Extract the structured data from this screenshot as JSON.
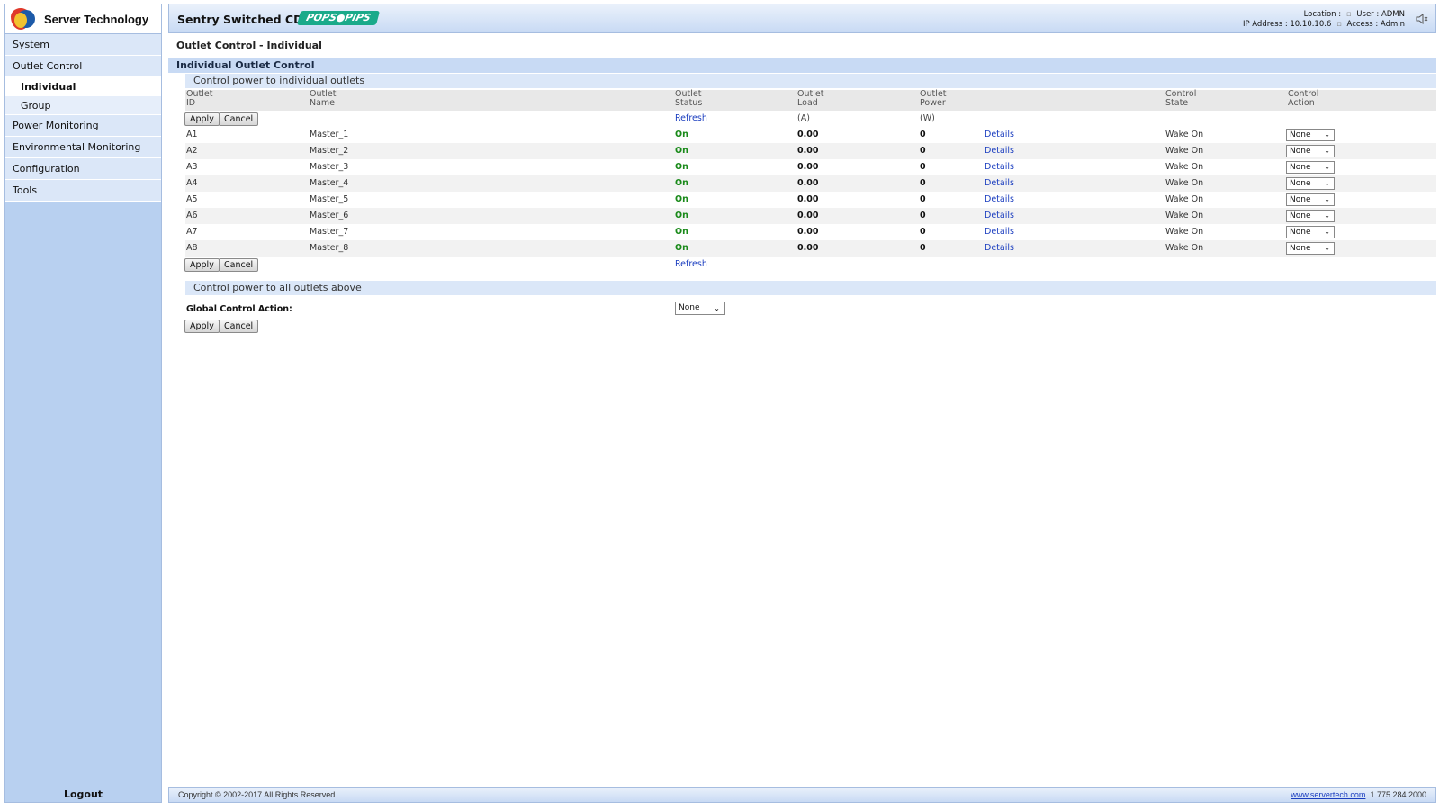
{
  "brand": {
    "company": "Server Technology",
    "product": "Sentry Switched CDU",
    "badge": "POPS●PIPS",
    "accent": "#1aaa8a"
  },
  "header": {
    "location_label": "Location :",
    "location_value": "",
    "user_label": "User : ADMN",
    "ip_label": "IP Address : 10.10.10.6",
    "access_label": "Access : Admin",
    "speaker_icon": "speaker-mute-icon"
  },
  "sidebar": {
    "items": [
      {
        "label": "System"
      },
      {
        "label": "Outlet Control"
      },
      {
        "label": "Individual",
        "active": true
      },
      {
        "label": "Group"
      },
      {
        "label": "Power Monitoring"
      },
      {
        "label": "Environmental Monitoring"
      },
      {
        "label": "Configuration"
      },
      {
        "label": "Tools"
      }
    ],
    "logout": "Logout"
  },
  "page": {
    "title": "Outlet Control - Individual",
    "section": "Individual Outlet Control",
    "subhead_individual": "Control power to individual outlets",
    "subhead_all": "Control power to all outlets above",
    "global_label": "Global Control Action:",
    "global_value": "None"
  },
  "table": {
    "headers": {
      "id": [
        "Outlet",
        "ID"
      ],
      "name": [
        "Outlet",
        "Name"
      ],
      "status": [
        "Outlet",
        "Status"
      ],
      "load": [
        "Outlet",
        "Load"
      ],
      "power": [
        "Outlet",
        "Power"
      ],
      "state": [
        "Control",
        "State"
      ],
      "action": [
        "Control",
        "Action"
      ]
    },
    "units": {
      "load": "(A)",
      "power": "(W)"
    },
    "buttons": {
      "apply": "Apply",
      "cancel": "Cancel",
      "refresh": "Refresh"
    },
    "rows": [
      {
        "id": "A1",
        "name": "Master_1",
        "status": "On",
        "load": "0.00",
        "power": "0",
        "details": "Details",
        "state": "Wake On",
        "action": "None"
      },
      {
        "id": "A2",
        "name": "Master_2",
        "status": "On",
        "load": "0.00",
        "power": "0",
        "details": "Details",
        "state": "Wake On",
        "action": "None"
      },
      {
        "id": "A3",
        "name": "Master_3",
        "status": "On",
        "load": "0.00",
        "power": "0",
        "details": "Details",
        "state": "Wake On",
        "action": "None"
      },
      {
        "id": "A4",
        "name": "Master_4",
        "status": "On",
        "load": "0.00",
        "power": "0",
        "details": "Details",
        "state": "Wake On",
        "action": "None"
      },
      {
        "id": "A5",
        "name": "Master_5",
        "status": "On",
        "load": "0.00",
        "power": "0",
        "details": "Details",
        "state": "Wake On",
        "action": "None"
      },
      {
        "id": "A6",
        "name": "Master_6",
        "status": "On",
        "load": "0.00",
        "power": "0",
        "details": "Details",
        "state": "Wake On",
        "action": "None"
      },
      {
        "id": "A7",
        "name": "Master_7",
        "status": "On",
        "load": "0.00",
        "power": "0",
        "details": "Details",
        "state": "Wake On",
        "action": "None"
      },
      {
        "id": "A8",
        "name": "Master_8",
        "status": "On",
        "load": "0.00",
        "power": "0",
        "details": "Details",
        "state": "Wake On",
        "action": "None"
      }
    ]
  },
  "footer": {
    "copyright": "Copyright © 2002-2017 All Rights Reserved.",
    "link": "www.servertech.com",
    "phone": "1.775.284.2000"
  }
}
